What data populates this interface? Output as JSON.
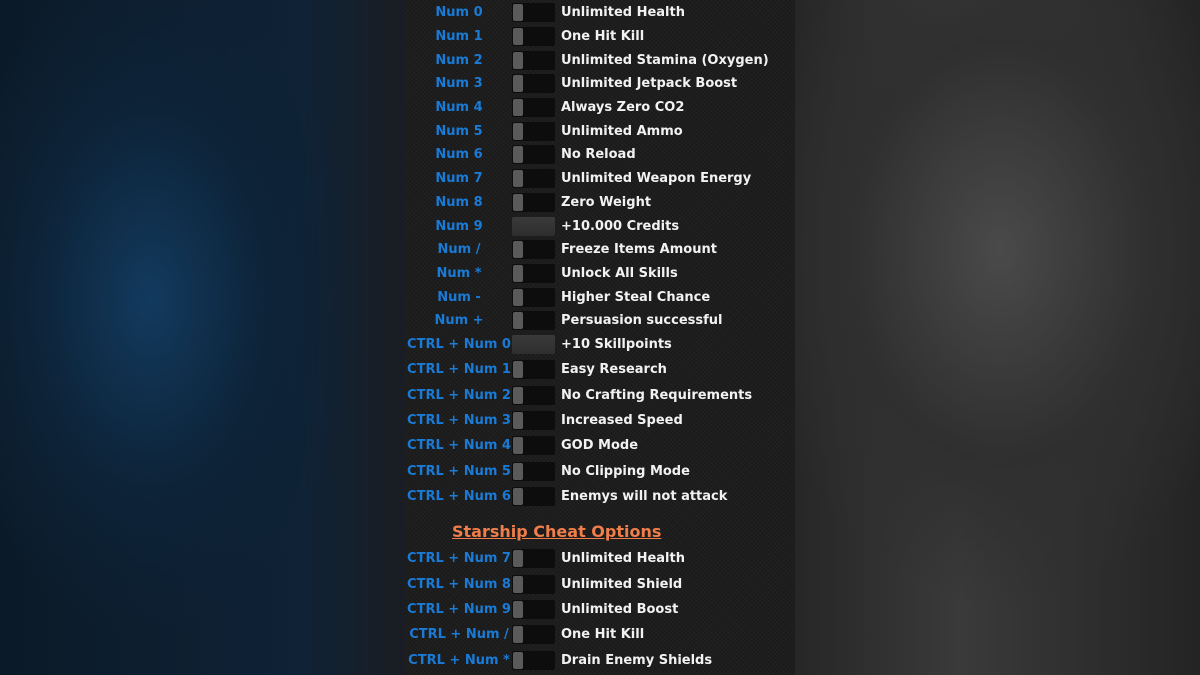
{
  "accent_key_color": "#1a7bd6",
  "header_color": "#ef7e4a",
  "sections": [
    {
      "rows": [
        {
          "key": "Num 0",
          "label": "Unlimited Health",
          "type": "toggle",
          "on": false
        },
        {
          "key": "Num 1",
          "label": "One Hit Kill",
          "type": "toggle",
          "on": false
        },
        {
          "key": "Num 2",
          "label": "Unlimited Stamina (Oxygen)",
          "type": "toggle",
          "on": false
        },
        {
          "key": "Num 3",
          "label": "Unlimited Jetpack Boost",
          "type": "toggle",
          "on": false
        },
        {
          "key": "Num 4",
          "label": "Always Zero CO2",
          "type": "toggle",
          "on": false
        },
        {
          "key": "Num 5",
          "label": "Unlimited Ammo",
          "type": "toggle",
          "on": false
        },
        {
          "key": "Num 6",
          "label": "No Reload",
          "type": "toggle",
          "on": false
        },
        {
          "key": "Num 7",
          "label": "Unlimited Weapon Energy",
          "type": "toggle",
          "on": false
        },
        {
          "key": "Num 8",
          "label": "Zero Weight",
          "type": "toggle",
          "on": false
        },
        {
          "key": "Num 9",
          "label": "+10.000 Credits",
          "type": "button"
        },
        {
          "key": "Num /",
          "label": "Freeze Items Amount",
          "type": "toggle",
          "on": false
        },
        {
          "key": "Num *",
          "label": "Unlock All Skills",
          "type": "toggle",
          "on": false
        },
        {
          "key": "Num -",
          "label": "Higher Steal Chance",
          "type": "toggle",
          "on": false
        },
        {
          "key": "Num +",
          "label": "Persuasion successful",
          "type": "toggle",
          "on": false
        },
        {
          "key": "CTRL + Num 0",
          "label": "+10 Skillpoints",
          "type": "button"
        }
      ]
    },
    {
      "rows": [
        {
          "key": "CTRL + Num 1",
          "label": "Easy Research",
          "type": "toggle",
          "on": false
        },
        {
          "key": "CTRL + Num 2",
          "label": "No Crafting Requirements",
          "type": "toggle",
          "on": false
        },
        {
          "key": "CTRL + Num 3",
          "label": "Increased Speed",
          "type": "toggle",
          "on": false
        },
        {
          "key": "CTRL + Num 4",
          "label": "GOD Mode",
          "type": "toggle",
          "on": false
        },
        {
          "key": "CTRL + Num 5",
          "label": "No Clipping Mode",
          "type": "toggle",
          "on": false
        },
        {
          "key": "CTRL + Num 6",
          "label": "Enemys will not attack",
          "type": "toggle",
          "on": false
        }
      ]
    },
    {
      "title": "Starship Cheat Options",
      "rows": [
        {
          "key": "CTRL + Num 7",
          "label": "Unlimited Health",
          "type": "toggle",
          "on": false
        },
        {
          "key": "CTRL + Num 8",
          "label": "Unlimited Shield",
          "type": "toggle",
          "on": false
        },
        {
          "key": "CTRL + Num 9",
          "label": "Unlimited Boost",
          "type": "toggle",
          "on": false
        },
        {
          "key": "CTRL + Num /",
          "label": "One Hit Kill",
          "type": "toggle",
          "on": false
        },
        {
          "key": "CTRL + Num *",
          "label": "Drain Enemy Shields",
          "type": "toggle",
          "on": false
        }
      ]
    }
  ]
}
